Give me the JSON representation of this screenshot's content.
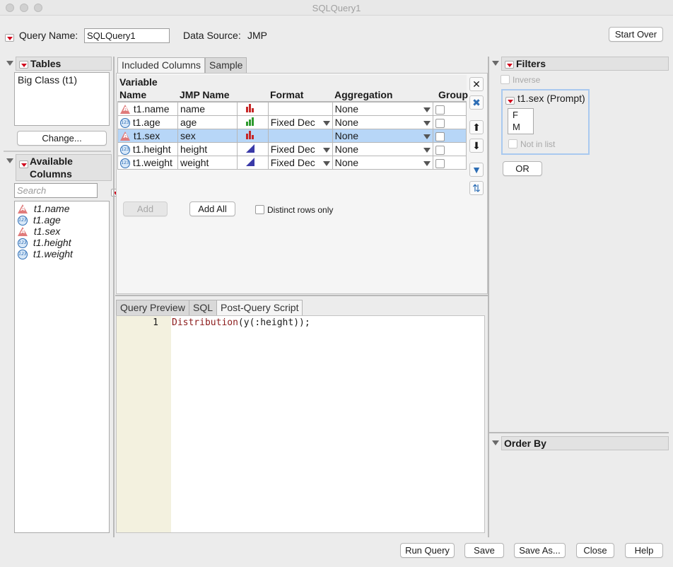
{
  "window": {
    "title": "SQLQuery1"
  },
  "top": {
    "query_name_label": "Query Name:",
    "query_name_value": "SQLQuery1",
    "data_source_label": "Data Source:",
    "data_source_value": "JMP",
    "start_over": "Start Over"
  },
  "tables": {
    "title": "Tables",
    "items": [
      "Big Class (t1)"
    ],
    "change_button": "Change..."
  },
  "available": {
    "title_line1": "Available",
    "title_line2": "Columns",
    "search_placeholder": "Search",
    "items": [
      {
        "name": "t1.name",
        "type": "character"
      },
      {
        "name": "t1.age",
        "type": "numeric"
      },
      {
        "name": "t1.sex",
        "type": "character"
      },
      {
        "name": "t1.height",
        "type": "numeric"
      },
      {
        "name": "t1.weight",
        "type": "numeric"
      }
    ]
  },
  "columns_tabs": [
    "Included Columns",
    "Sample"
  ],
  "columns_table": {
    "headers": {
      "variable_line1": "Variable",
      "variable_line2": "Name",
      "jmp_name": "JMP Name",
      "format": "Format",
      "aggregation": "Aggregation",
      "group": "Group"
    },
    "rows": [
      {
        "variable": "t1.name",
        "jmp_name": "name",
        "format": "",
        "aggregation": "None",
        "type": "character",
        "modeling": "nominal"
      },
      {
        "variable": "t1.age",
        "jmp_name": "age",
        "format": "Fixed Dec",
        "aggregation": "None",
        "type": "numeric",
        "modeling": "ordinal"
      },
      {
        "variable": "t1.sex",
        "jmp_name": "sex",
        "format": "",
        "aggregation": "None",
        "type": "character",
        "modeling": "nominal",
        "selected": true
      },
      {
        "variable": "t1.height",
        "jmp_name": "height",
        "format": "Fixed Dec",
        "aggregation": "None",
        "type": "numeric",
        "modeling": "continuous"
      },
      {
        "variable": "t1.weight",
        "jmp_name": "weight",
        "format": "Fixed Dec",
        "aggregation": "None",
        "type": "numeric",
        "modeling": "continuous"
      }
    ]
  },
  "column_actions": {
    "add": "Add",
    "add_all": "Add All",
    "distinct_label": "Distinct rows only"
  },
  "script_tabs": [
    "Query Preview",
    "SQL",
    "Post-Query Script"
  ],
  "script": {
    "line_number": "1",
    "fn": "Distribution",
    "rest": "(y(:height));"
  },
  "filters": {
    "title": "Filters",
    "inverse_label": "Inverse",
    "filter_title": "t1.sex (Prompt)",
    "values": [
      "F",
      "M"
    ],
    "not_in_list_label": "Not in list",
    "or_button": "OR"
  },
  "order_by": {
    "title": "Order By"
  },
  "bottom_buttons": [
    "Run Query",
    "Save",
    "Save As...",
    "Close",
    "Help"
  ],
  "colors": {
    "selection": "#b7d6f7",
    "red_triangle": "#d0021b",
    "script_fn": "#8b1a1a",
    "gutter": "#f3f1df"
  }
}
